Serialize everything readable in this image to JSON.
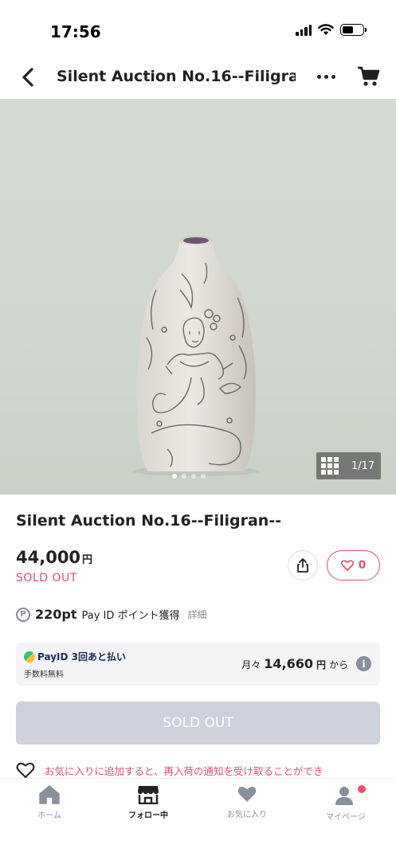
{
  "status_bar": {
    "time": "17:56"
  },
  "header": {
    "title": "Silent Auction No.16--Filigran...",
    "back_icon": "chevron-left-icon",
    "more_icon": "more-horizontal-icon",
    "cart_icon": "cart-icon"
  },
  "gallery": {
    "counter": "1/17",
    "grid_icon": "grid-icon",
    "current_index": 1,
    "total": 17
  },
  "product": {
    "title": "Silent Auction No.16--Filigran--",
    "price": "44,000",
    "currency": "円",
    "status": "SOLD OUT",
    "favorite_count": "0"
  },
  "points": {
    "value": "220pt",
    "text": "Pay ID ポイント獲得",
    "link": "詳細"
  },
  "payid": {
    "brand": "PayID 3回あと払い",
    "fee_note": "手数料無料",
    "monthly_label": "月々",
    "monthly_amount": "14,660",
    "monthly_currency": "円",
    "monthly_suffix": "から"
  },
  "purchase_button": {
    "label": "SOLD OUT"
  },
  "restock_notice": {
    "text": "お気に入りに追加すると、再入荷の通知を受け取ることができ"
  },
  "tabbar": {
    "tabs": [
      {
        "label": "ホーム",
        "icon": "home-icon"
      },
      {
        "label": "フォロー中",
        "icon": "shop-icon"
      },
      {
        "label": "お気に入り",
        "icon": "heart-icon"
      },
      {
        "label": "マイページ",
        "icon": "user-icon"
      }
    ]
  },
  "colors": {
    "accent_pink": "#e0506d",
    "disabled_button": "#cdd1db",
    "text_primary": "#222222",
    "tab_inactive": "#8a8f9c"
  }
}
